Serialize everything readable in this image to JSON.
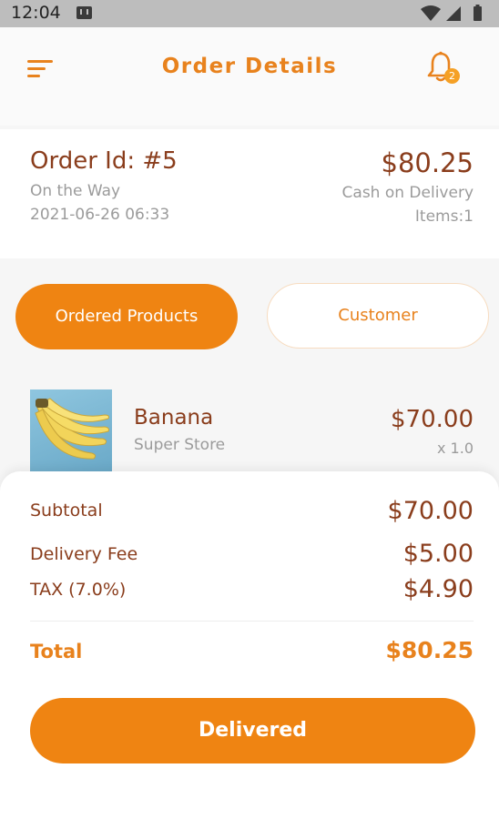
{
  "status_bar": {
    "time": "12:04",
    "icons": [
      "message-icon",
      "wifi-icon",
      "signal-icon",
      "battery-icon"
    ]
  },
  "header": {
    "title": "Order Details",
    "menu_icon": "menu-icon",
    "notification_icon": "bell-icon",
    "notification_count": "2"
  },
  "order": {
    "id_label": "Order Id: #5",
    "status": "On the Way",
    "datetime": "2021-06-26 06:33",
    "total": "$80.25",
    "payment_method": "Cash on Delivery",
    "items": "Items:1"
  },
  "tabs": [
    {
      "label": "Ordered Products",
      "active": true
    },
    {
      "label": "Customer",
      "active": false
    }
  ],
  "products": [
    {
      "name": "Banana",
      "store": "Super Store",
      "price": "$70.00",
      "quantity": "x 1.0"
    }
  ],
  "summary": {
    "subtotal_label": "Subtotal",
    "subtotal_value": "$70.00",
    "delivery_fee_label": "Delivery Fee",
    "delivery_fee_value": "$5.00",
    "tax_label": "TAX (7.0%)",
    "tax_value": "$4.90",
    "total_label": "Total",
    "total_value": "$80.25"
  },
  "action": {
    "button_label": "Delivered"
  },
  "colors": {
    "accent": "#ef8412",
    "primary_text": "#8a3d1c",
    "secondary_text": "#9b9b9b"
  }
}
